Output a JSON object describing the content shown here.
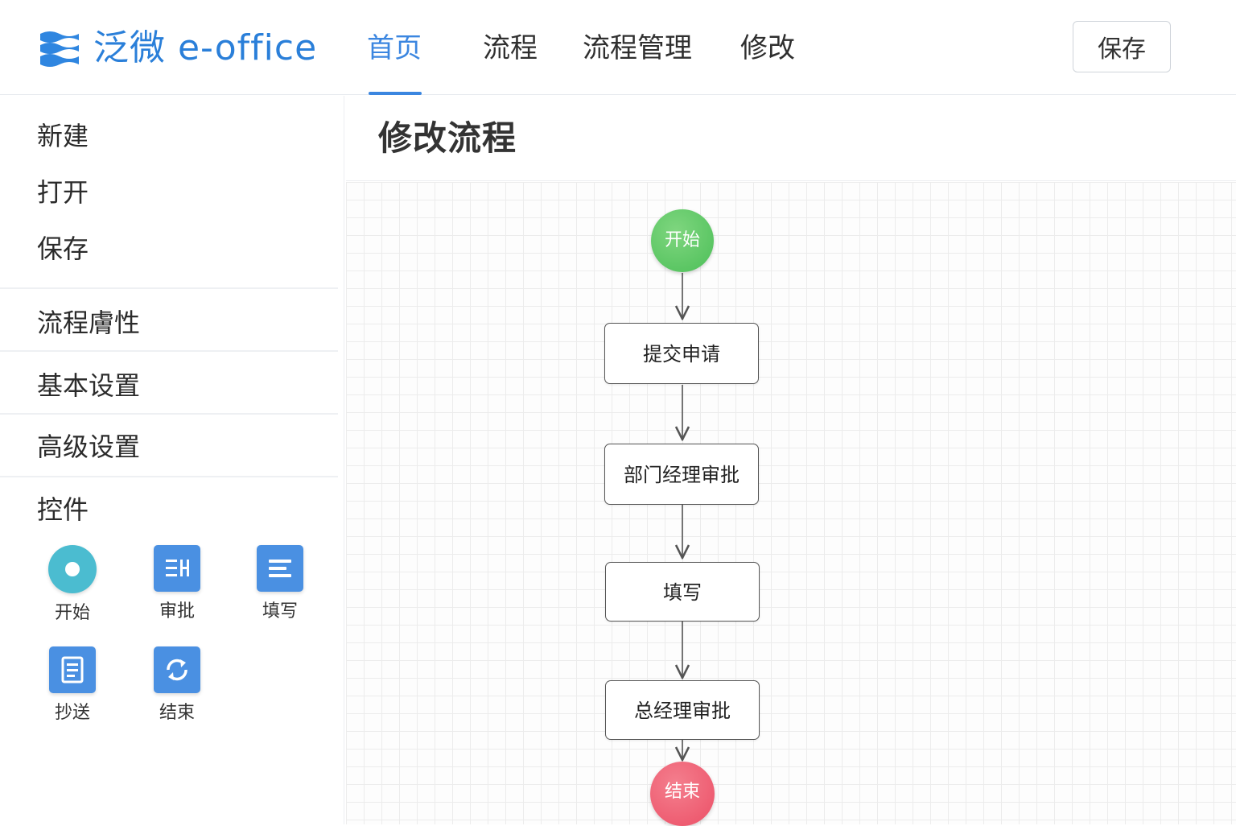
{
  "header": {
    "brand": "泛微 e-office",
    "nav": [
      {
        "label": "首页",
        "active": true
      },
      {
        "label": "流程"
      },
      {
        "label": "流程管理"
      },
      {
        "label": "修改"
      }
    ],
    "save_label": "保存"
  },
  "sidebar": {
    "file_items": [
      "新建",
      "打开",
      "保存"
    ],
    "sections": [
      "流程膚性",
      "基本设置",
      "高级设置"
    ],
    "controls_title": "控件",
    "tools": [
      {
        "label": "开始",
        "icon": "start-circle-icon"
      },
      {
        "label": "审批",
        "icon": "approve-icon"
      },
      {
        "label": "填写",
        "icon": "fill-icon"
      },
      {
        "label": "抄送",
        "icon": "cc-icon"
      },
      {
        "label": "结束",
        "icon": "refresh-icon"
      }
    ]
  },
  "main": {
    "title": "修改流程",
    "flow": {
      "start": "开始",
      "steps": [
        "提交申请",
        "部门经理审批",
        "填写",
        "总经理审批"
      ],
      "end": "结束"
    }
  },
  "colors": {
    "accent": "#3b86e0",
    "brand": "#2a7fd9",
    "start_node": "#5cc45f",
    "end_node": "#ef5b6e",
    "tool_blue": "#4a90e2",
    "tool_teal": "#4bbcd0"
  }
}
